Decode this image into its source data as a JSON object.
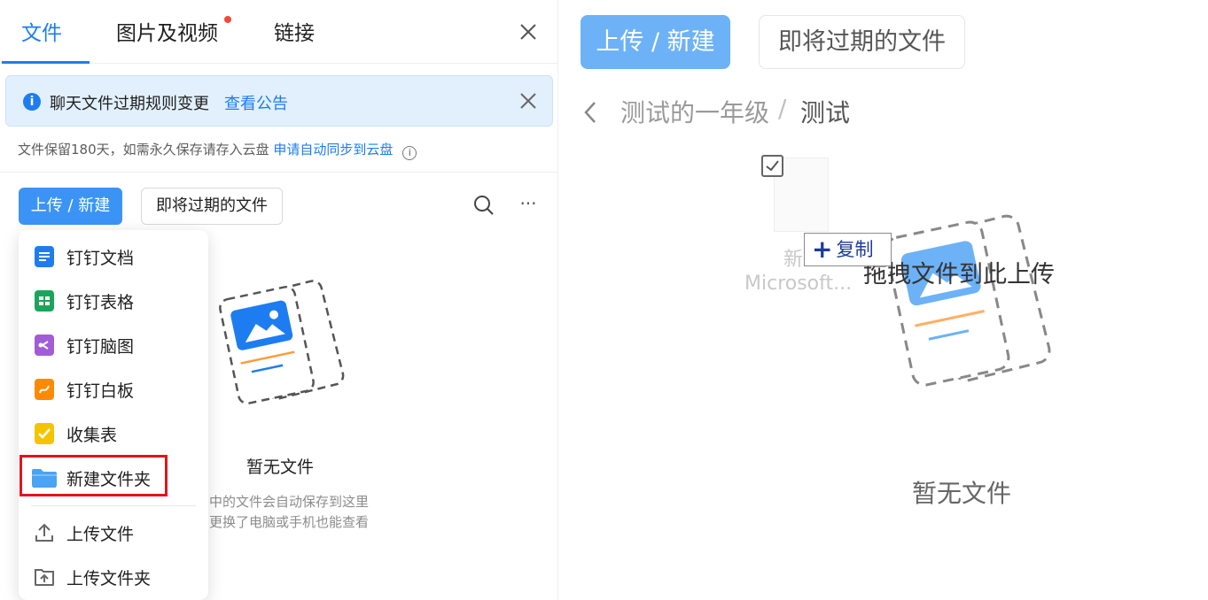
{
  "tabs": [
    {
      "label": "文件"
    },
    {
      "label": "图片及视频"
    },
    {
      "label": "链接"
    }
  ],
  "notice": {
    "text": "聊天文件过期规则变更",
    "link": "查看公告",
    "info_icon": "i"
  },
  "retention": {
    "text": "文件保留180天，如需永久保存请存入云盘",
    "link": "申请自动同步到云盘",
    "help_icon": "i"
  },
  "toolbar": {
    "upload_label": "上传 / 新建",
    "expiring_label": "即将过期的文件",
    "more_label": "···"
  },
  "menu": {
    "items": [
      {
        "label": "钉钉文档",
        "color": "#1d7df0"
      },
      {
        "label": "钉钉表格",
        "color": "#19a65b"
      },
      {
        "label": "钉钉脑图",
        "color": "#a25cd8"
      },
      {
        "label": "钉钉白板",
        "color": "#ff8a00"
      },
      {
        "label": "收集表",
        "color": "#f5c400"
      },
      {
        "label": "新建文件夹",
        "color": "#4aa3f3"
      },
      {
        "label": "上传文件",
        "color": "#666666"
      },
      {
        "label": "上传文件夹",
        "color": "#666666"
      }
    ]
  },
  "empty_left": {
    "title": "暂无文件",
    "desc_line1": "中的文件会自动保存到这里",
    "desc_line2": "更换了电脑或手机也能查看"
  },
  "right": {
    "upload_label": "上传 / 新建",
    "expiring_label": "即将过期的文件",
    "breadcrumb": [
      "测试的一年级",
      "测试"
    ],
    "breadcrumb_sep": "/",
    "drag_name_1": "新",
    "drag_name_2": "Microsoft...",
    "copy_tip": "复制",
    "copy_plus": "+",
    "drag_hint": "拖拽文件到此上传",
    "empty_title": "暂无文件"
  },
  "colors": {
    "accent": "#1d7df0",
    "highlight": "#e3141b",
    "notice_bg": "#e2f0fd"
  }
}
